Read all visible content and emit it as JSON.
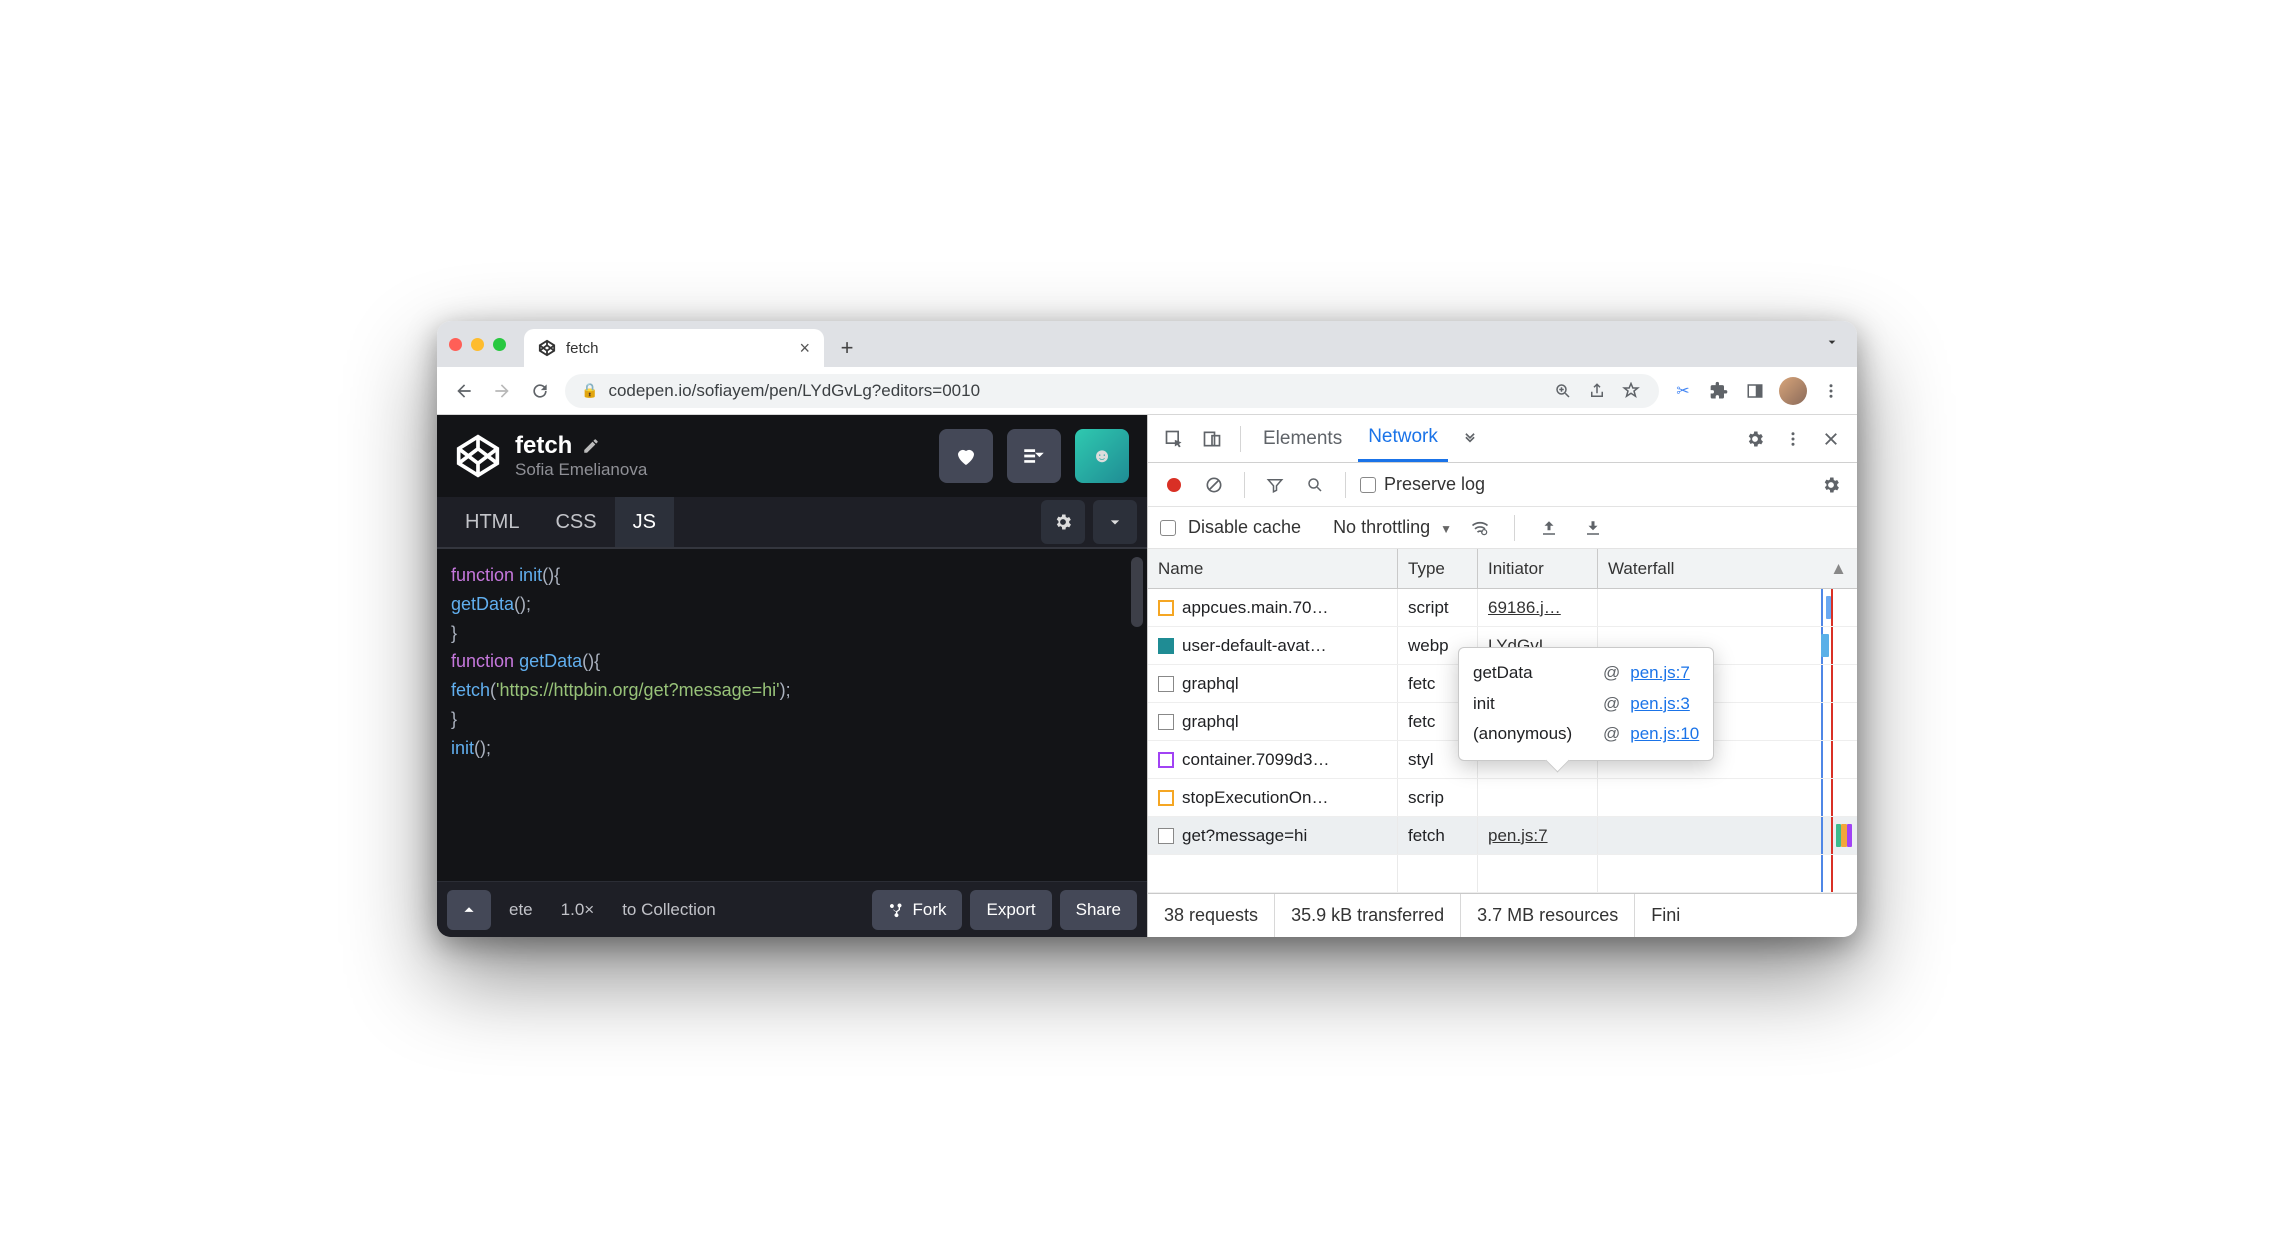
{
  "browser_tab": {
    "title": "fetch"
  },
  "url": "codepen.io/sofiayem/pen/LYdGvLg?editors=0010",
  "codepen": {
    "title": "fetch",
    "author": "Sofia Emelianova",
    "editor_tabs": [
      "HTML",
      "CSS",
      "JS"
    ],
    "code_lines": [
      [
        {
          "cls": "kw",
          "t": "function"
        },
        {
          "cls": "pn",
          "t": " "
        },
        {
          "cls": "fn",
          "t": "init"
        },
        {
          "cls": "pn",
          "t": "(){"
        }
      ],
      [
        {
          "cls": "pn",
          "t": "  "
        },
        {
          "cls": "fn",
          "t": "getData"
        },
        {
          "cls": "pn",
          "t": "();"
        }
      ],
      [
        {
          "cls": "pn",
          "t": "}"
        }
      ],
      [
        {
          "cls": "pn",
          "t": ""
        }
      ],
      [
        {
          "cls": "kw",
          "t": "function"
        },
        {
          "cls": "pn",
          "t": " "
        },
        {
          "cls": "fn",
          "t": "getData"
        },
        {
          "cls": "pn",
          "t": "(){"
        }
      ],
      [
        {
          "cls": "pn",
          "t": "  "
        },
        {
          "cls": "fn",
          "t": "fetch"
        },
        {
          "cls": "pn",
          "t": "("
        },
        {
          "cls": "str",
          "t": "'https://httpbin.org/get?message=hi'"
        },
        {
          "cls": "pn",
          "t": ");"
        }
      ],
      [
        {
          "cls": "pn",
          "t": "}"
        }
      ],
      [
        {
          "cls": "pn",
          "t": ""
        }
      ],
      [
        {
          "cls": "fn",
          "t": "init"
        },
        {
          "cls": "pn",
          "t": "();"
        }
      ]
    ],
    "footer": {
      "delete_fragment": "ete",
      "zoom": "1.0×",
      "to_collection": "to Collection",
      "fork": "Fork",
      "export": "Export",
      "share": "Share"
    }
  },
  "devtools": {
    "tabs": {
      "elements": "Elements",
      "network": "Network"
    },
    "preserve_log": "Preserve log",
    "disable_cache": "Disable cache",
    "throttling": "No throttling",
    "columns": {
      "name": "Name",
      "type": "Type",
      "initiator": "Initiator",
      "waterfall": "Waterfall"
    },
    "rows": [
      {
        "icon": "js",
        "name": "appcues.main.70…",
        "type": "script",
        "initiator": "69186.j…",
        "waterfall": [
          [
            88,
            2,
            "#6aa8f1"
          ]
        ]
      },
      {
        "icon": "img",
        "name": "user-default-avat…",
        "type": "webp",
        "initiator": "LYdGvL…",
        "waterfall": [
          [
            86,
            3,
            "#5ab0e8"
          ]
        ]
      },
      {
        "icon": "doc",
        "name": "graphql",
        "type": "fetc",
        "initiator": "",
        "waterfall": []
      },
      {
        "icon": "doc",
        "name": "graphql",
        "type": "fetc",
        "initiator": "",
        "waterfall": []
      },
      {
        "icon": "css",
        "name": "container.7099d3…",
        "type": "styl",
        "initiator": "",
        "waterfall": []
      },
      {
        "icon": "js",
        "name": "stopExecutionOn…",
        "type": "scrip",
        "initiator": "",
        "waterfall": []
      },
      {
        "icon": "doc",
        "name": "get?message=hi",
        "type": "fetch",
        "initiator": "pen.js:7",
        "selected": true,
        "waterfall": [
          [
            92,
            2,
            "#3bbb8c"
          ],
          [
            94,
            2,
            "#f2a63a"
          ],
          [
            96,
            2,
            "#a142f4"
          ]
        ]
      }
    ],
    "tooltip": [
      {
        "fn": "getData",
        "at": "@",
        "loc": "pen.js:7"
      },
      {
        "fn": "init",
        "at": "@",
        "loc": "pen.js:3"
      },
      {
        "fn": "(anonymous)",
        "at": "@",
        "loc": "pen.js:10"
      }
    ],
    "status": {
      "requests": "38 requests",
      "transferred": "35.9 kB transferred",
      "resources": "3.7 MB resources",
      "finish": "Fini"
    }
  }
}
